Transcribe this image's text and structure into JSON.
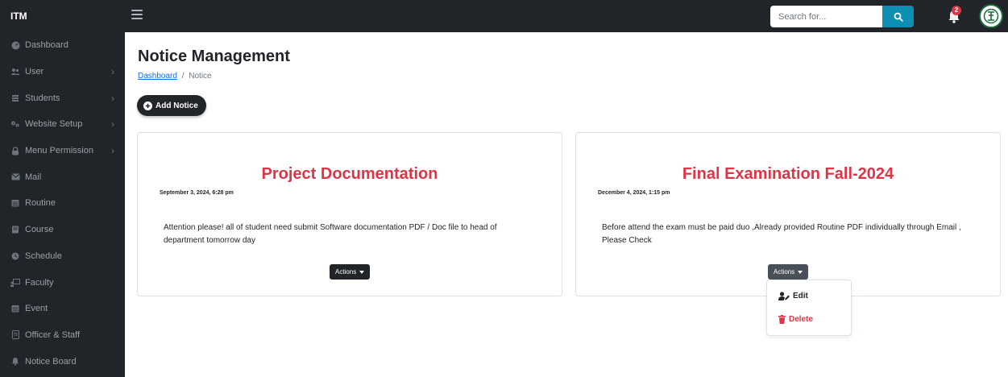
{
  "app": {
    "brand": "ITM"
  },
  "topbar": {
    "search_placeholder": "Search for...",
    "notification_count": "2"
  },
  "sidebar": {
    "items": [
      {
        "label": "Dashboard",
        "icon": "dashboard-icon",
        "has_submenu": false
      },
      {
        "label": "User",
        "icon": "users-icon",
        "has_submenu": true
      },
      {
        "label": "Students",
        "icon": "students-icon",
        "has_submenu": true
      },
      {
        "label": "Website Setup",
        "icon": "gears-icon",
        "has_submenu": true
      },
      {
        "label": "Menu Permission",
        "icon": "lock-icon",
        "has_submenu": true
      },
      {
        "label": "Mail",
        "icon": "mail-icon",
        "has_submenu": false
      },
      {
        "label": "Routine",
        "icon": "calendar-icon",
        "has_submenu": false
      },
      {
        "label": "Course",
        "icon": "book-icon",
        "has_submenu": false
      },
      {
        "label": "Schedule",
        "icon": "clock-icon",
        "has_submenu": false
      },
      {
        "label": "Faculty",
        "icon": "faculty-icon",
        "has_submenu": false
      },
      {
        "label": "Event",
        "icon": "calendar-icon",
        "has_submenu": false
      },
      {
        "label": "Officer & Staff",
        "icon": "id-card-icon",
        "has_submenu": false
      },
      {
        "label": "Notice Board",
        "icon": "bell-icon",
        "has_submenu": false
      }
    ]
  },
  "main": {
    "title": "Notice Management",
    "breadcrumb": {
      "link": "Dashboard",
      "separator": "/",
      "current": "Notice"
    },
    "add_button": "Add Notice",
    "notices": [
      {
        "title": "Project Documentation",
        "date": "September 3, 2024, 6:28 pm",
        "body": "Attention please! all of student need submit Software documentation PDF / Doc file to head of department tomorrow day",
        "actions_label": "Actions"
      },
      {
        "title": "Final Examination Fall-2024",
        "date": "December 4, 2024, 1:15 pm",
        "body": "Before attend the exam must be paid duo ,Already provided Routine PDF individually through Email , Please Check",
        "actions_label": "Actions"
      }
    ],
    "dropdown": {
      "edit": "Edit",
      "delete": "Delete"
    }
  },
  "colors": {
    "dark": "#212529",
    "accent": "#dc3545",
    "search_button": "#0d8fb3",
    "link": "#0d6efd"
  }
}
